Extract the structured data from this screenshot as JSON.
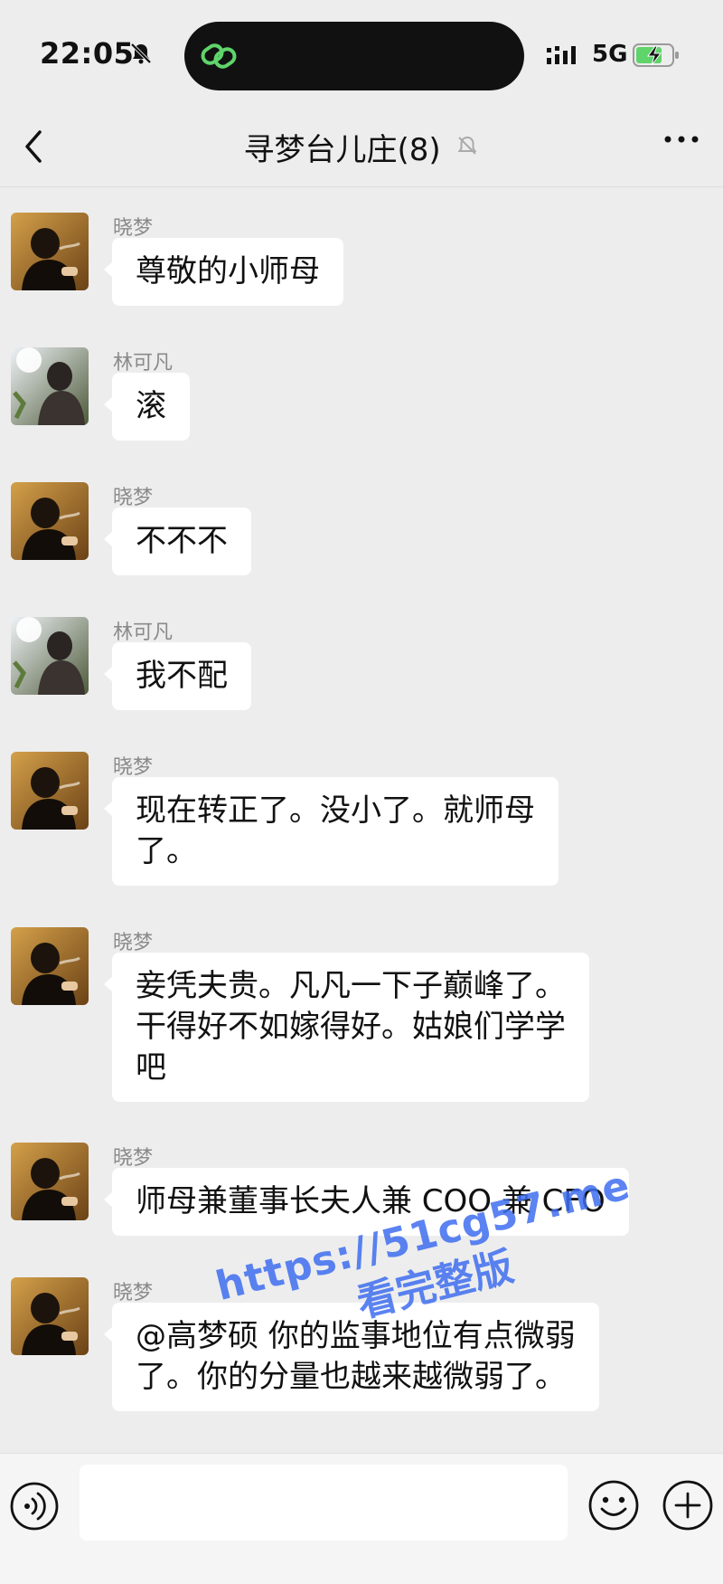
{
  "status_bar": {
    "time": "22:05",
    "network": "5G",
    "icons": [
      "bell-off-icon",
      "island-link-icon",
      "signal-icon",
      "battery-charging-icon"
    ]
  },
  "nav": {
    "title": "寻梦台儿庄(8)",
    "icons": [
      "back-arrow-icon",
      "muted-bell-icon",
      "more-dots-icon"
    ]
  },
  "messages": [
    {
      "sender": "晓梦",
      "lines": [
        "尊敬的小师母"
      ]
    },
    {
      "sender": "林可凡",
      "lines": [
        "滚"
      ]
    },
    {
      "sender": "晓梦",
      "lines": [
        "不不不"
      ]
    },
    {
      "sender": "林可凡",
      "lines": [
        "我不配"
      ]
    },
    {
      "sender": "晓梦",
      "lines": [
        "现在转正了。没小了。就师母",
        "了。"
      ]
    },
    {
      "sender": "晓梦",
      "lines": [
        "妾凭夫贵。凡凡一下子巅峰了。",
        "干得好不如嫁得好。姑娘们学学",
        "吧"
      ]
    },
    {
      "sender": "晓梦",
      "lines": [
        "师母兼董事长夫人兼 COO 兼 CFO"
      ]
    },
    {
      "sender": "晓梦",
      "lines": [
        "@高梦硕 你的监事地位有点微弱",
        "了。你的分量也越来越微弱了。"
      ]
    }
  ],
  "watermark": {
    "line1": "https://51cg57.me",
    "line2": "看完整版"
  },
  "input_bar": {
    "icons": [
      "voice-icon",
      "emoji-icon",
      "plus-icon"
    ]
  },
  "colors": {
    "background": "#ededed",
    "bubble": "#ffffff",
    "island": "#111111",
    "island_accent": "#5fd46b",
    "watermark": "#3f6ef0"
  }
}
